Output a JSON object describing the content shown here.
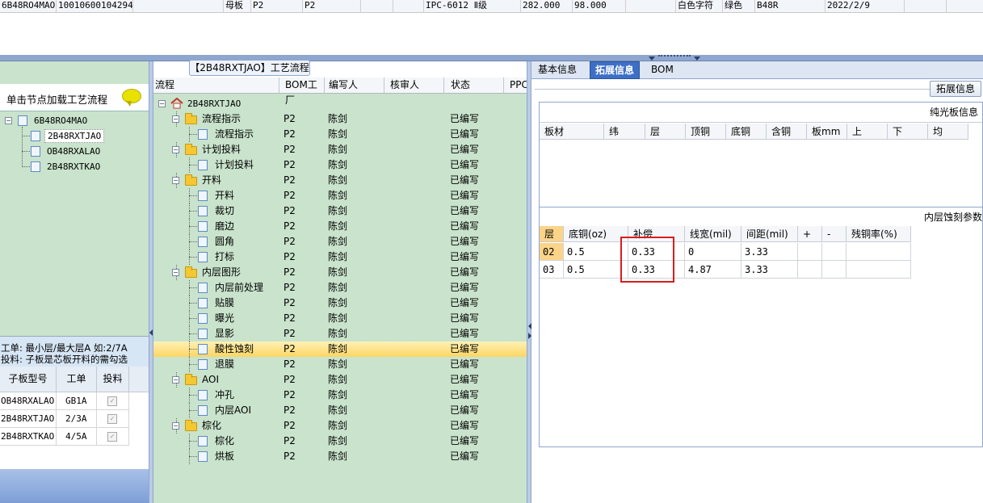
{
  "top_row": [
    "6B48RO4MAO",
    "10010600104294",
    "",
    "母板",
    "P2",
    "P2",
    "",
    "",
    "IPC-6012 Ⅱ级",
    "282.000",
    "98.000",
    "",
    "白色字符",
    "绿色",
    "B48R",
    "2022/2/9",
    ""
  ],
  "left": {
    "hint": "单击节点加载工艺流程",
    "tree_root": "6B48RO4MAO",
    "tree_children": [
      "2B48RXTJAO",
      "OB48RXALAO",
      "2B48RXTKAO"
    ],
    "info_line1": "工单: 最小层/最大层A 如:2/7A",
    "info_line2": "投料: 子板是芯板开料的需勾选",
    "grid_headers": [
      "子板型号",
      "工单",
      "投料"
    ],
    "grid_rows": [
      {
        "model": "OB48RXALAO",
        "order": "GB1A",
        "feed": "✓"
      },
      {
        "model": "2B48RXTJAO",
        "order": "2/3A",
        "feed": "✓"
      },
      {
        "model": "2B48RXTKAO",
        "order": "4/5A",
        "feed": "✓"
      }
    ]
  },
  "middle": {
    "caption": "【2B48RXTJAO】工艺流程",
    "headers": [
      "流程",
      "BOM工厂",
      "编写人",
      "核审人",
      "状态",
      "PPC"
    ],
    "root": "2B48RXTJAO",
    "rows": [
      {
        "name": "流程指示",
        "type": "folder",
        "factory": "P2",
        "writer": "陈剑",
        "status": "已编写"
      },
      {
        "name": "流程指示",
        "type": "doc",
        "factory": "P2",
        "writer": "陈剑",
        "status": "已编写"
      },
      {
        "name": "计划投料",
        "type": "folder",
        "factory": "P2",
        "writer": "陈剑",
        "status": "已编写"
      },
      {
        "name": "计划投料",
        "type": "doc",
        "factory": "P2",
        "writer": "陈剑",
        "status": "已编写"
      },
      {
        "name": "开料",
        "type": "folder",
        "factory": "P2",
        "writer": "陈剑",
        "status": "已编写"
      },
      {
        "name": "开料",
        "type": "doc",
        "factory": "P2",
        "writer": "陈剑",
        "status": "已编写"
      },
      {
        "name": "裁切",
        "type": "doc",
        "factory": "P2",
        "writer": "陈剑",
        "status": "已编写"
      },
      {
        "name": "磨边",
        "type": "doc",
        "factory": "P2",
        "writer": "陈剑",
        "status": "已编写"
      },
      {
        "name": "圆角",
        "type": "doc",
        "factory": "P2",
        "writer": "陈剑",
        "status": "已编写"
      },
      {
        "name": "打标",
        "type": "doc",
        "factory": "P2",
        "writer": "陈剑",
        "status": "已编写"
      },
      {
        "name": "内层图形",
        "type": "folder",
        "factory": "P2",
        "writer": "陈剑",
        "status": "已编写"
      },
      {
        "name": "内层前处理",
        "type": "doc",
        "factory": "P2",
        "writer": "陈剑",
        "status": "已编写"
      },
      {
        "name": "贴膜",
        "type": "doc",
        "factory": "P2",
        "writer": "陈剑",
        "status": "已编写"
      },
      {
        "name": "曝光",
        "type": "doc",
        "factory": "P2",
        "writer": "陈剑",
        "status": "已编写"
      },
      {
        "name": "显影",
        "type": "doc",
        "factory": "P2",
        "writer": "陈剑",
        "status": "已编写"
      },
      {
        "name": "酸性蚀刻",
        "type": "doc",
        "factory": "P2",
        "writer": "陈剑",
        "status": "已编写",
        "selected": true
      },
      {
        "name": "退膜",
        "type": "doc",
        "factory": "P2",
        "writer": "陈剑",
        "status": "已编写"
      },
      {
        "name": "AOI",
        "type": "folder",
        "factory": "P2",
        "writer": "陈剑",
        "status": "已编写"
      },
      {
        "name": "冲孔",
        "type": "doc",
        "factory": "P2",
        "writer": "陈剑",
        "status": "已编写"
      },
      {
        "name": "内层AOI",
        "type": "doc",
        "factory": "P2",
        "writer": "陈剑",
        "status": "已编写"
      },
      {
        "name": "棕化",
        "type": "folder",
        "factory": "P2",
        "writer": "陈剑",
        "status": "已编写"
      },
      {
        "name": "棕化",
        "type": "doc",
        "factory": "P2",
        "writer": "陈剑",
        "status": "已编写"
      },
      {
        "name": "烘板",
        "type": "doc",
        "factory": "P2",
        "writer": "陈剑",
        "status": "已编写"
      }
    ]
  },
  "right": {
    "tabs": [
      "基本信息",
      "拓展信息",
      "BOM"
    ],
    "expand_button": "拓展信息",
    "light_section": "纯光板信息",
    "light_headers": [
      "板材",
      "纬",
      "层",
      "顶铜",
      "底铜",
      "含铜",
      "板mm",
      "上",
      "下",
      "均"
    ],
    "etch_section": "内层蚀刻参数",
    "etch_headers": [
      "层",
      "底铜(oz)",
      "补偿",
      "线宽(mil)",
      "间距(mil)",
      "+",
      "-",
      "残铜率(%)"
    ],
    "etch_rows": [
      {
        "layer": "02",
        "bottom_cu": "0.5",
        "comp": "0.33",
        "line": "0",
        "space": "3.33",
        "plus": "",
        "minus": "",
        "residual": ""
      },
      {
        "layer": "03",
        "bottom_cu": "0.5",
        "comp": "0.33",
        "line": "4.87",
        "space": "3.33",
        "plus": "",
        "minus": "",
        "residual": ""
      }
    ]
  },
  "colors": {
    "panel_green": "#c9e3cc",
    "accent_blue": "#3d6fc7",
    "selected": "#fcd664",
    "highlight": "#d91c1c"
  }
}
